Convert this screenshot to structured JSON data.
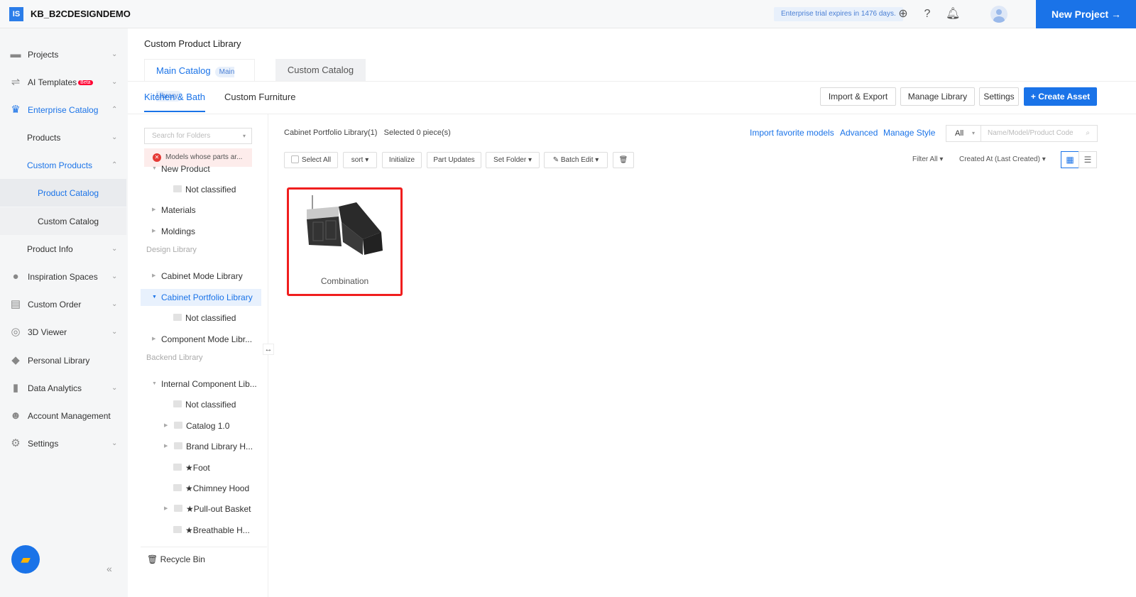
{
  "header": {
    "logo": "IS",
    "brand": "KB_B2CDESIGNDEMO",
    "trial": "Enterprise trial expires in 1476 days.",
    "new_project": "New Project →"
  },
  "sidebar": {
    "items": [
      {
        "label": "Projects",
        "icon": "folder-icon"
      },
      {
        "label": "AI Templates",
        "badge": "Beta",
        "icon": "ai-icon"
      },
      {
        "label": "Enterprise Catalog",
        "icon": "crown-icon"
      },
      {
        "label": "Products"
      },
      {
        "label": "Custom Products"
      },
      {
        "label": "Product Catalog"
      },
      {
        "label": "Custom Catalog"
      },
      {
        "label": "Product Info"
      },
      {
        "label": "Inspiration Spaces",
        "icon": "bulb-icon"
      },
      {
        "label": "Custom Order",
        "icon": "clipboard-icon"
      },
      {
        "label": "3D Viewer",
        "icon": "viewer-icon"
      },
      {
        "label": "Personal Library",
        "icon": "box-icon"
      },
      {
        "label": "Data Analytics",
        "icon": "chart-icon"
      },
      {
        "label": "Account Management",
        "icon": "user-icon"
      },
      {
        "label": "Settings",
        "icon": "gear-icon"
      }
    ]
  },
  "page": {
    "title": "Custom Product Library",
    "tabs": {
      "main": "Main Catalog",
      "main_badge": "Main Library",
      "custom": "Custom Catalog"
    },
    "subtabs": [
      "Kitchen & Bath",
      "Custom Furniture"
    ],
    "actions": {
      "import_export": "Import & Export",
      "manage_library": "Manage Library",
      "settings": "Settings",
      "create": "+ Create Asset"
    }
  },
  "tree": {
    "search_placeholder": "Search for Folders",
    "warning": "Models whose parts ar...",
    "rows": [
      "New Product",
      "Not classified",
      "Materials",
      "Moldings",
      "Design Library",
      "Cabinet Mode Library",
      "Cabinet Portfolio Library",
      "Not classified",
      "Component Mode Libr...",
      "Backend Library",
      "Internal Component Lib...",
      "Not classified",
      "Catalog 1.0",
      "Brand Library H...",
      "★Foot",
      "★Chimney Hood",
      "★Pull-out Basket",
      "★Breathable H..."
    ],
    "recycle": "Recycle Bin"
  },
  "content": {
    "crumb": "Cabinet Portfolio Library(1)",
    "selected": "Selected 0 piece(s)",
    "links": [
      "Import favorite models",
      "Advanced",
      "Manage Style"
    ],
    "scope": "All",
    "search_placeholder": "Name/Model/Product Code",
    "toolbar": [
      "Select All",
      "sort ▾",
      "Initialize",
      "Part Updates",
      "Set Folder ▾",
      "Batch Edit ▾"
    ],
    "filter": "Filter All ▾",
    "sort_by": "Created At (Last Created) ▾",
    "cards": [
      {
        "name": "Combination"
      }
    ]
  }
}
